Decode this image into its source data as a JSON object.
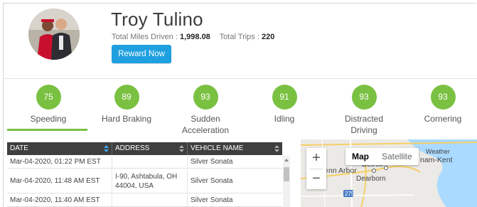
{
  "profile": {
    "name": "Troy Tulino",
    "miles_label": "Total Miles Driven : ",
    "miles_value": "1,998.08",
    "trips_label": "Total Trips : ",
    "trips_value": "220",
    "reward_button": "Reward Now"
  },
  "scores": [
    {
      "value": "75",
      "label": "Speeding"
    },
    {
      "value": "89",
      "label": "Hard Braking"
    },
    {
      "value": "93",
      "label": "Sudden Acceleration"
    },
    {
      "value": "91",
      "label": "Idling"
    },
    {
      "value": "93",
      "label": "Distracted Driving"
    },
    {
      "value": "93",
      "label": "Cornering"
    }
  ],
  "table": {
    "headers": [
      "DATE",
      "ADDRESS",
      "VEHICLE NAME"
    ],
    "rows": [
      [
        "Mar-04-2020, 01:22 PM EST",
        "",
        "Silver Sonata"
      ],
      [
        "Mar-04-2020, 11:48 AM EST",
        "I-90, Ashtabula, OH 44004, USA",
        "Silver Sonata"
      ],
      [
        "Mar-04-2020, 11:40 AM EST",
        "",
        "Silver Sonata"
      ]
    ]
  },
  "map": {
    "type_map": "Map",
    "type_satellite": "Satellite",
    "zoom_in": "+",
    "zoom_out": "−",
    "labels": {
      "weather": "Weather",
      "nam_kent": "nam-Kent",
      "ann_arbor": "nn Arbor",
      "detroit": "Detroit",
      "dearborn": "Dearborn",
      "route": "275"
    }
  },
  "colors": {
    "accent_green": "#7ac142",
    "button_blue": "#1e9fdf",
    "table_header": "#3f3f3f",
    "lake_blue": "#aadaff"
  }
}
